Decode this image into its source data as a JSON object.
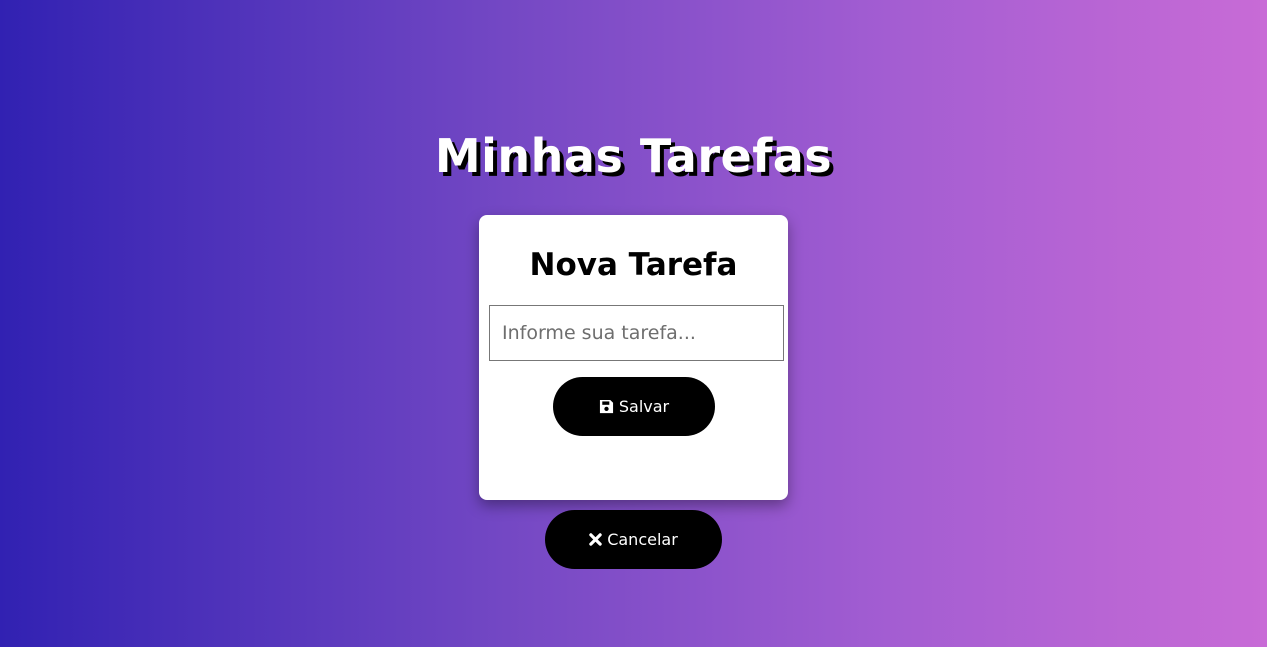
{
  "page": {
    "title": "Minhas Tarefas"
  },
  "card": {
    "title": "Nova Tarefa",
    "input": {
      "value": "",
      "placeholder": "Informe sua tarefa..."
    },
    "save_button": {
      "label": "Salvar",
      "icon": "floppy-disk-icon"
    }
  },
  "cancel_button": {
    "label": "Cancelar",
    "icon": "close-icon"
  },
  "colors": {
    "gradient_start": "#3121b2",
    "gradient_end": "#c86bd6",
    "button_bg": "#000000",
    "card_bg": "#ffffff"
  }
}
